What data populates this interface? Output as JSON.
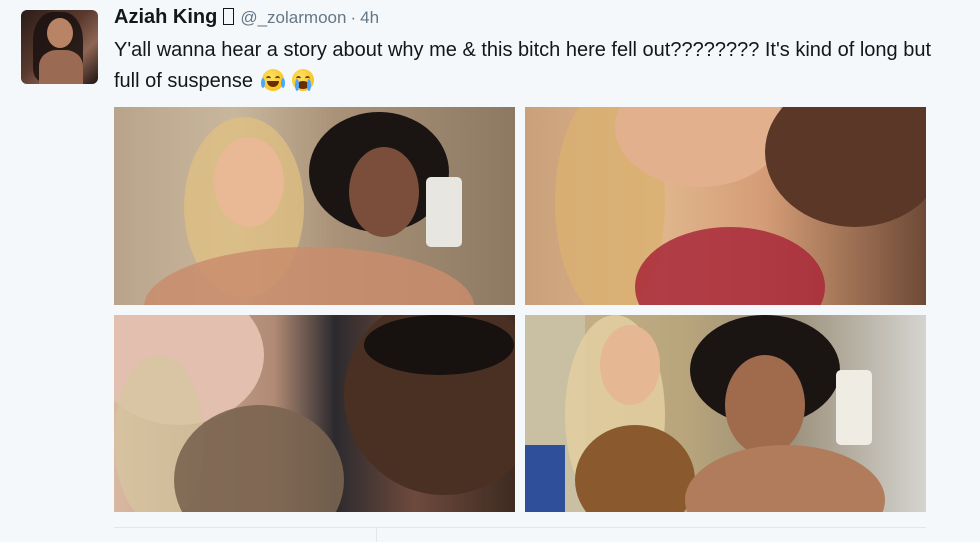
{
  "tweet": {
    "author_name": "Aziah King",
    "handle": "@_zolarmoon",
    "separator": "·",
    "time": "4h",
    "text": "Y'all wanna hear a story about why me & this bitch here fell out???????? It's kind of long but full of suspense",
    "emojis": [
      "face-with-tears-of-joy",
      "loudly-crying-face"
    ]
  },
  "media": {
    "photos": [
      {
        "icon": "photo-two-women-selfie"
      },
      {
        "icon": "photo-close-up-selfie"
      },
      {
        "icon": "photo-faces-close-up"
      },
      {
        "icon": "photo-locker-selfie"
      }
    ]
  },
  "colors": {
    "background": "#f5f8fa",
    "text": "#14171a",
    "secondary_text": "#657786",
    "divider": "#e1e8ed"
  }
}
